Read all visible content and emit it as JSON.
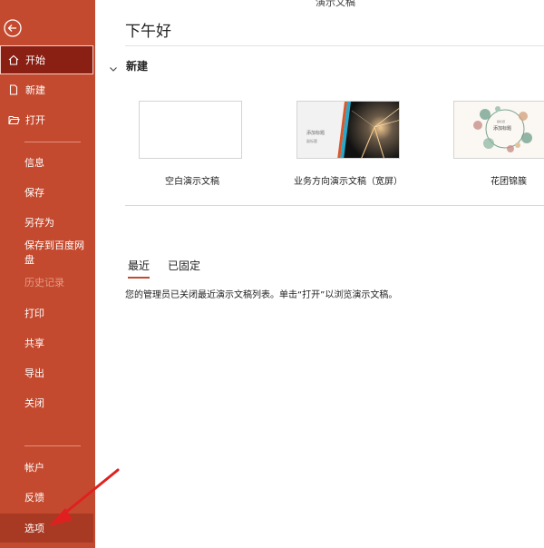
{
  "window": {
    "title_fragment": "演示文稿"
  },
  "sidebar": {
    "back_icon": "back-arrow-circle-icon",
    "top_items": [
      {
        "label": "开始",
        "icon": "home-icon"
      },
      {
        "label": "新建",
        "icon": "new-file-icon"
      },
      {
        "label": "打开",
        "icon": "folder-open-icon"
      }
    ],
    "middle_items": [
      {
        "label": "信息"
      },
      {
        "label": "保存"
      },
      {
        "label": "另存为"
      },
      {
        "label": "保存到百度网盘"
      },
      {
        "label": "历史记录"
      },
      {
        "label": "打印"
      },
      {
        "label": "共享"
      },
      {
        "label": "导出"
      },
      {
        "label": "关闭"
      }
    ],
    "bottom_items": [
      {
        "label": "帐户"
      },
      {
        "label": "反馈"
      },
      {
        "label": "选项"
      }
    ]
  },
  "main": {
    "greeting": "下午好",
    "new_section": "新建",
    "templates": [
      {
        "label": "空白演示文稿"
      },
      {
        "label": "业务方向演示文稿（宽屏）",
        "thumb_text": "添加标题",
        "thumb_subtext": "副标题"
      },
      {
        "label": "花团锦簇",
        "thumb_text": "添加标题",
        "thumb_subtext": "副标题"
      }
    ],
    "tabs": [
      {
        "label": "最近"
      },
      {
        "label": "已固定"
      }
    ],
    "message": "您的管理员已关闭最近演示文稿列表。单击“打开”以浏览演示文稿。"
  },
  "colors": {
    "sidebar": "#c44a2f",
    "active": "#8a1f14",
    "annotation_arrow": "#e02020"
  }
}
